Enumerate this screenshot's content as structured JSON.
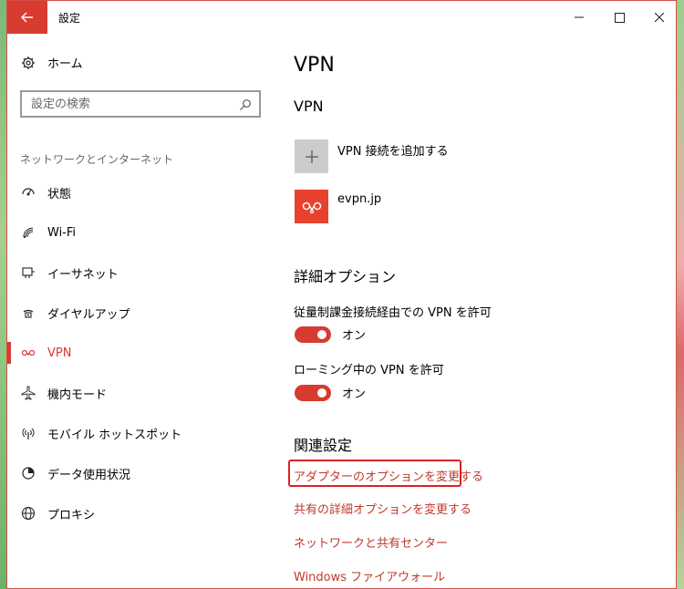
{
  "window": {
    "title": "設定",
    "back_icon": "arrow-left-icon",
    "accent": "#d83b30"
  },
  "sidebar": {
    "home_label": "ホーム",
    "search_placeholder": "設定の検索",
    "section_label": "ネットワークとインターネット",
    "items": [
      {
        "label": "状態",
        "icon": "status-icon"
      },
      {
        "label": "Wi-Fi",
        "icon": "wifi-icon"
      },
      {
        "label": "イーサネット",
        "icon": "ethernet-icon"
      },
      {
        "label": "ダイヤルアップ",
        "icon": "dialup-icon"
      },
      {
        "label": "VPN",
        "icon": "vpn-icon",
        "active": true
      },
      {
        "label": "機内モード",
        "icon": "airplane-icon"
      },
      {
        "label": "モバイル ホットスポット",
        "icon": "hotspot-icon"
      },
      {
        "label": "データ使用状況",
        "icon": "data-usage-icon"
      },
      {
        "label": "プロキシ",
        "icon": "globe-icon"
      }
    ]
  },
  "main": {
    "page_title": "VPN",
    "vpn_heading": "VPN",
    "add_vpn_label": "VPN 接続を追加する",
    "connection_name": "evpn.jp",
    "advanced_heading": "詳細オプション",
    "option1_label": "従量制課金接続経由での VPN を許可",
    "option1_state": "オン",
    "option2_label": "ローミング中の VPN を許可",
    "option2_state": "オン",
    "related_heading": "関連設定",
    "links": [
      "アダプターのオプションを変更する",
      "共有の詳細オプションを変更する",
      "ネットワークと共有センター",
      "Windows ファイアウォール"
    ]
  }
}
